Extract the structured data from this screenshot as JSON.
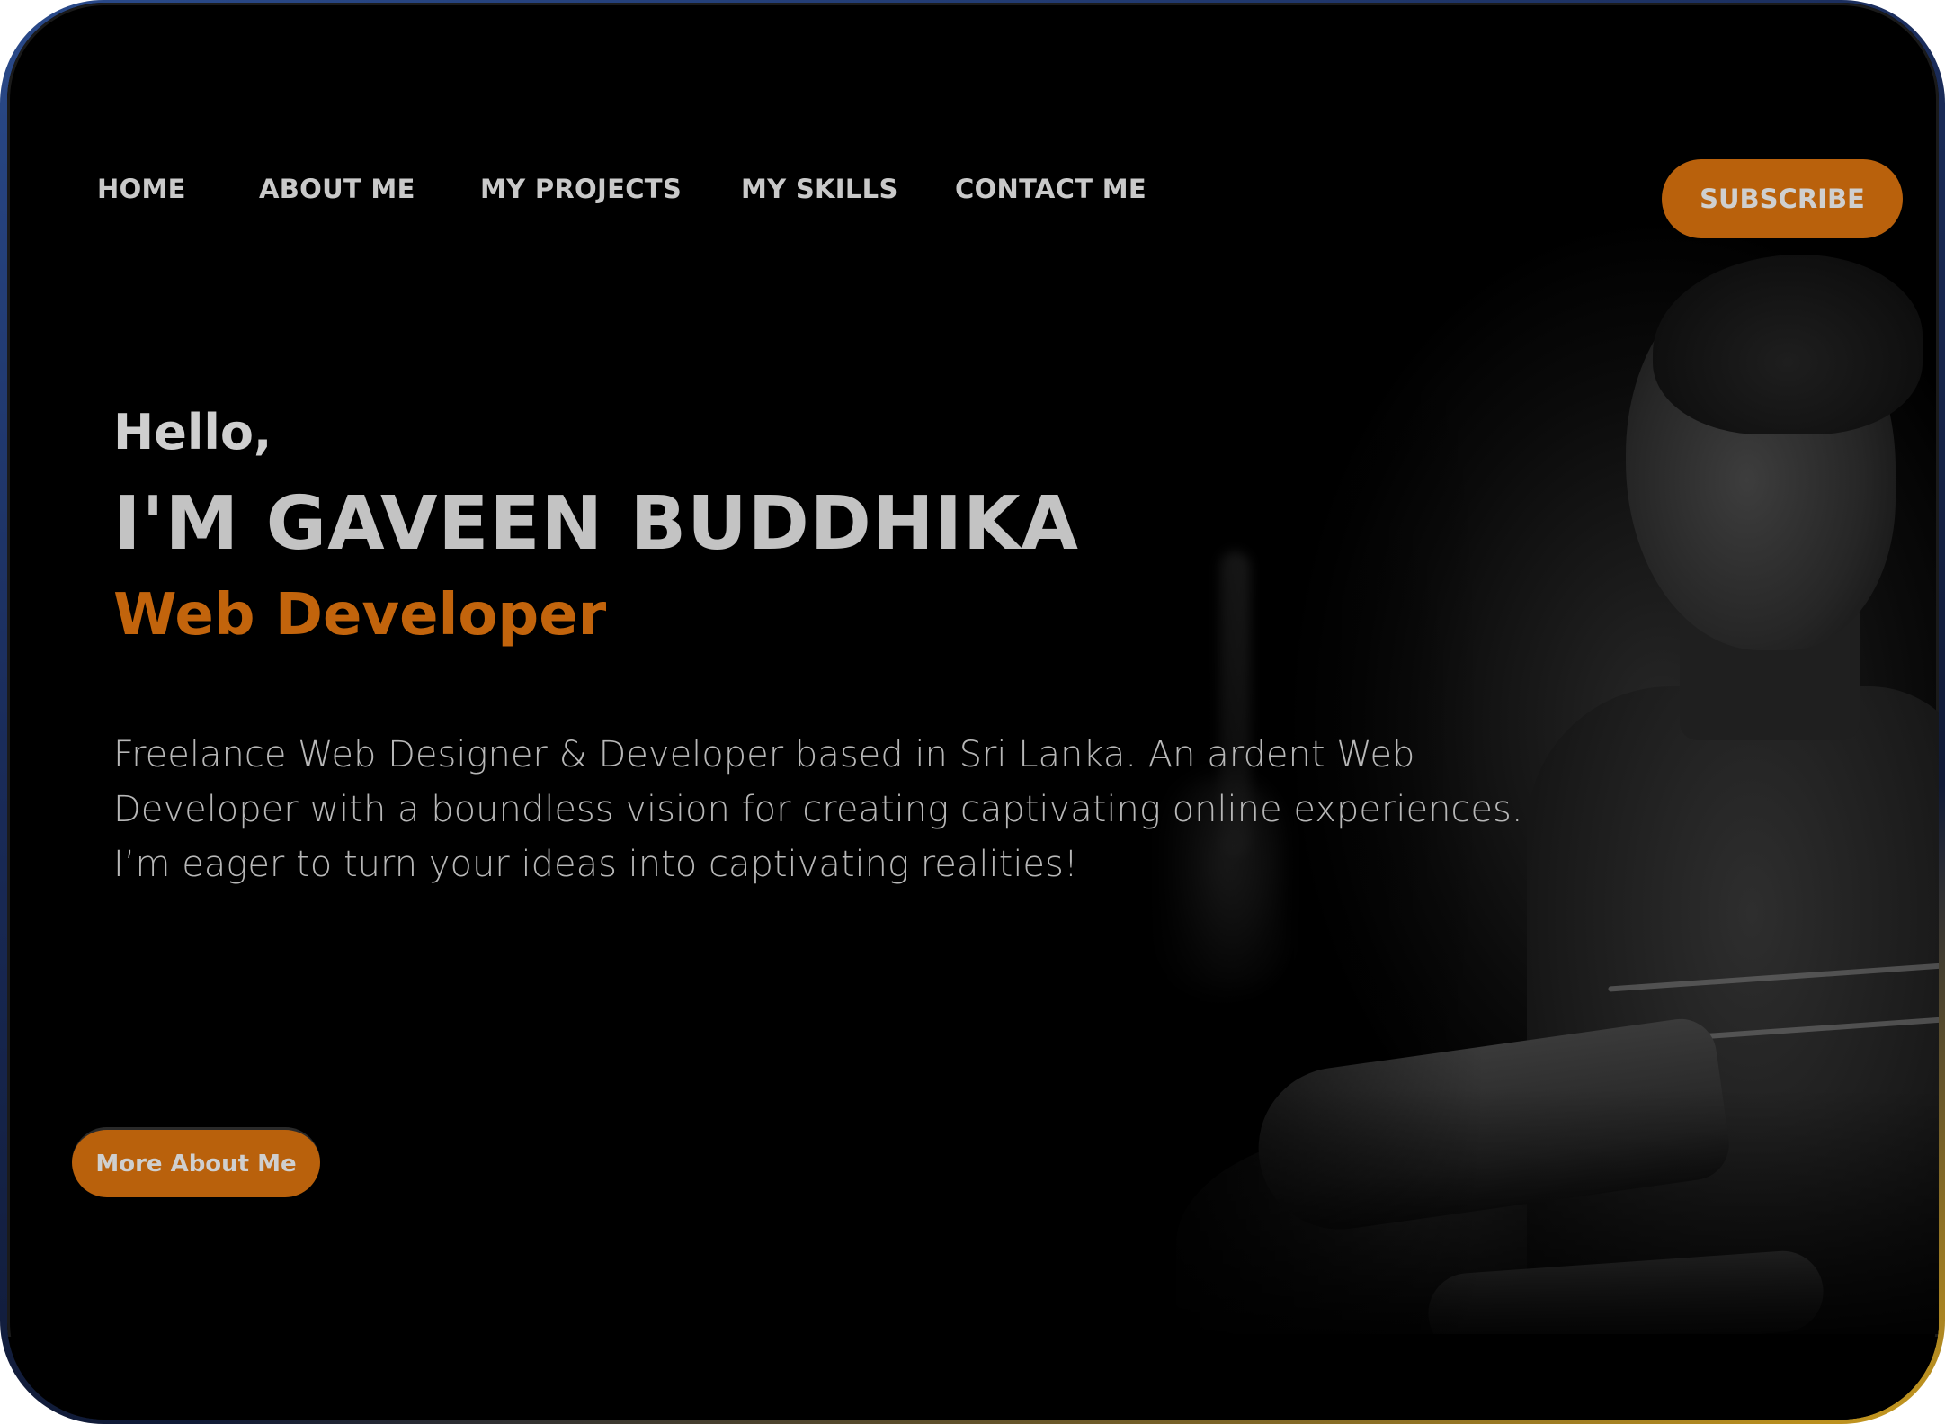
{
  "nav": {
    "items": [
      {
        "label": "HOME"
      },
      {
        "label": "ABOUT ME"
      },
      {
        "label": "MY PROJECTS"
      },
      {
        "label": "MY SKILLS"
      },
      {
        "label": "CONTACT ME"
      }
    ],
    "subscribe_label": "SUBSCRIBE"
  },
  "hero": {
    "greeting": "Hello,",
    "name": "I'M GAVEEN BUDDHIKA",
    "role": "Web Developer",
    "description": "Freelance Web Designer & Developer based in Sri Lanka. An ardent Web Developer with a boundless vision for creating captivating online experiences. I’m eager to turn your ideas into captivating realities!",
    "cta_label": "More About Me"
  },
  "colors": {
    "accent": "#b9610c",
    "background": "#000000",
    "text": "#c9c9c9"
  }
}
